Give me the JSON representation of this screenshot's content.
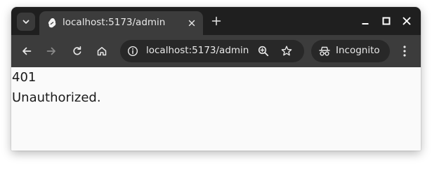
{
  "browser": {
    "tab": {
      "title": "localhost:5173/admin",
      "favicon": "sveltekit-icon"
    },
    "omnibox": {
      "url": "localhost:5173/admin"
    },
    "profile": {
      "label": "Incognito"
    },
    "icons": {
      "tab_search": "chevron-down-icon",
      "tab_close": "close-icon",
      "new_tab": "plus-icon",
      "minimize": "minimize-icon",
      "maximize": "maximize-icon",
      "close_window": "close-icon",
      "back": "arrow-left-icon",
      "forward": "arrow-right-icon",
      "reload": "reload-icon",
      "home": "home-icon",
      "site_info": "info-icon",
      "zoom": "zoom-icon",
      "bookmark": "star-icon",
      "incognito": "incognito-icon",
      "menu": "kebab-menu-icon"
    },
    "colors": {
      "titlebar": "#1f1f1f",
      "toolbar": "#3c3c3c",
      "omnibox": "#282828",
      "page_background": "#fafafa",
      "text_light": "#e8e8e8"
    }
  },
  "page": {
    "status_code": "401",
    "message": "Unauthorized."
  }
}
